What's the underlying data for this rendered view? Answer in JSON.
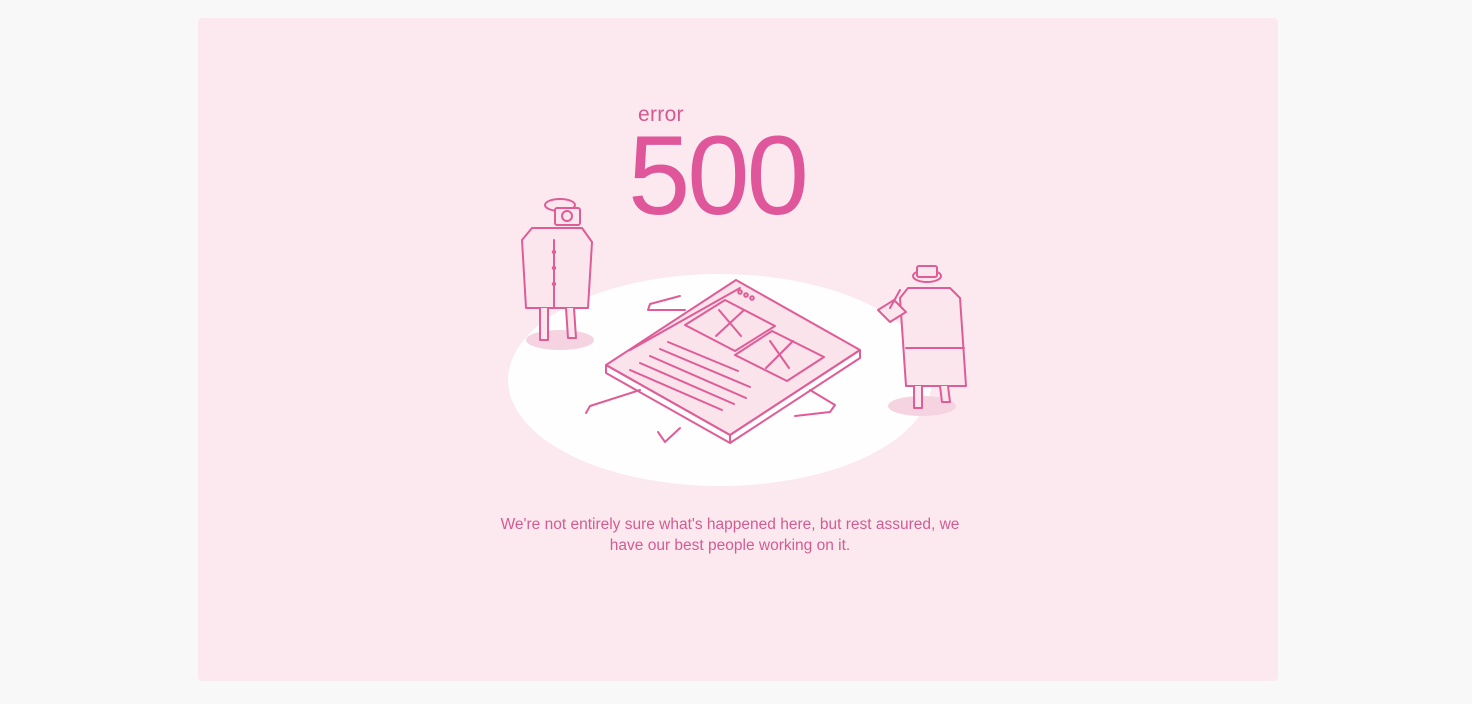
{
  "error": {
    "label": "error",
    "code": "500",
    "message": "We're not entirely sure what's happened here, but rest assured, we have our best people working on it."
  },
  "illustration": {
    "icon": "crime-scene-browser-illustration",
    "accent_color": "#e0569a",
    "background_color": "#fbe9ef"
  }
}
